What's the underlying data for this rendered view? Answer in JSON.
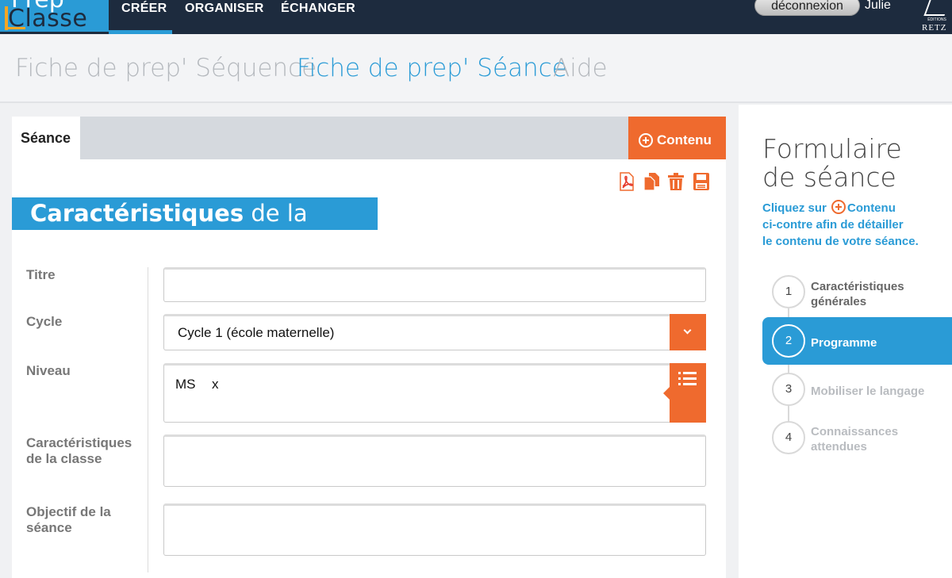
{
  "app": {
    "logo_top": "Prep",
    "logo_bottom": "Classe",
    "nav": [
      "CRÉER",
      "ORGANISER",
      "ÉCHANGER"
    ],
    "logout_label": "déconnexion",
    "user": "Julie",
    "publisher_small": "ÉDITIONS",
    "publisher": "RETZ"
  },
  "subnav": {
    "items": [
      "Fiche de prep' Séquence",
      "Fiche de prep' Séance",
      "Aide"
    ],
    "active_index": 1
  },
  "panel": {
    "tab_label": "Séance",
    "contenu_label": "Contenu",
    "toolbar_icons": [
      "pdf-icon",
      "copy-icon",
      "trash-icon",
      "save-icon"
    ],
    "section_title_bold": "Caractéristiques",
    "section_title_light": "de la séance",
    "fields": {
      "titre_label": "Titre",
      "titre_value": "",
      "cycle_label": "Cycle",
      "cycle_value": "Cycle 1 (école maternelle)",
      "niveau_label": "Niveau",
      "niveau_tag": "MS",
      "niveau_remove": "x",
      "classe_label_1": "Caractéristiques",
      "classe_label_2": "de la classe",
      "classe_value": "",
      "objectif_label_1": "Objectif de la",
      "objectif_label_2": "séance",
      "objectif_value": ""
    }
  },
  "sidebar": {
    "title_1": "Formulaire",
    "title_2": "de séance",
    "help_1": "Cliquez sur",
    "help_link": "Contenu",
    "help_2": "ci-contre afin de détailler",
    "help_3": "le contenu de votre séance.",
    "steps": [
      {
        "num": "1",
        "label_1": "Caractéristiques",
        "label_2": "générales",
        "state": "done"
      },
      {
        "num": "2",
        "label_1": "Programme",
        "label_2": "",
        "state": "active"
      },
      {
        "num": "3",
        "label_1": "Mobiliser le langage",
        "label_2": "",
        "state": "todo"
      },
      {
        "num": "4",
        "label_1": "Connaissances",
        "label_2": "attendues",
        "state": "todo"
      }
    ]
  },
  "colors": {
    "nav_bg": "#1d2b3e",
    "brand_blue": "#2a9bd6",
    "accent_orange": "#ef6a2e",
    "inactive_text": "#b4b8bd"
  }
}
